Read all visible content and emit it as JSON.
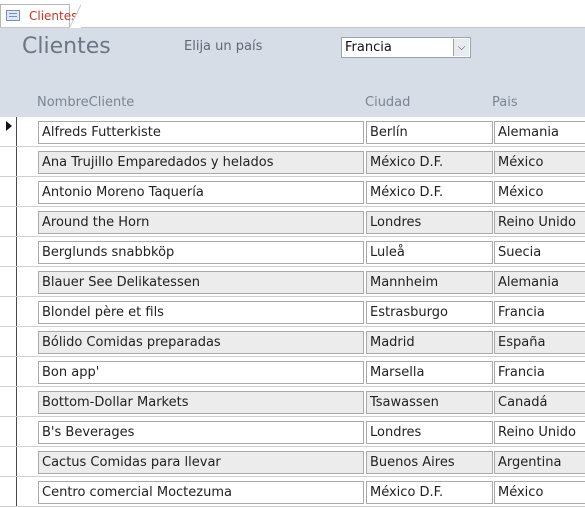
{
  "tab": {
    "label": "Clientes",
    "icon": "form-icon"
  },
  "header": {
    "title": "Clientes",
    "country_label": "Elija un país",
    "country_value": "Francia"
  },
  "columns": {
    "name": "NombreCliente",
    "city": "Ciudad",
    "country": "Pais"
  },
  "rows": [
    {
      "name": "Alfreds Futterkiste",
      "city": "Berlín",
      "country": "Alemania"
    },
    {
      "name": "Ana Trujillo Emparedados y helados",
      "city": "México D.F.",
      "country": "México"
    },
    {
      "name": "Antonio Moreno Taquería",
      "city": "México D.F.",
      "country": "México"
    },
    {
      "name": "Around the Horn",
      "city": "Londres",
      "country": "Reino Unido"
    },
    {
      "name": "Berglunds snabbköp",
      "city": "Luleå",
      "country": "Suecia"
    },
    {
      "name": "Blauer See Delikatessen",
      "city": "Mannheim",
      "country": "Alemania"
    },
    {
      "name": "Blondel père et fils",
      "city": "Estrasburgo",
      "country": "Francia"
    },
    {
      "name": "Bólido Comidas preparadas",
      "city": "Madrid",
      "country": "España"
    },
    {
      "name": "Bon app'",
      "city": "Marsella",
      "country": "Francia"
    },
    {
      "name": "Bottom-Dollar Markets",
      "city": "Tsawassen",
      "country": "Canadá"
    },
    {
      "name": "B's Beverages",
      "city": "Londres",
      "country": "Reino Unido"
    },
    {
      "name": "Cactus Comidas para llevar",
      "city": "Buenos Aires",
      "country": "Argentina"
    },
    {
      "name": "Centro comercial Moctezuma",
      "city": "México D.F.",
      "country": "México"
    }
  ]
}
